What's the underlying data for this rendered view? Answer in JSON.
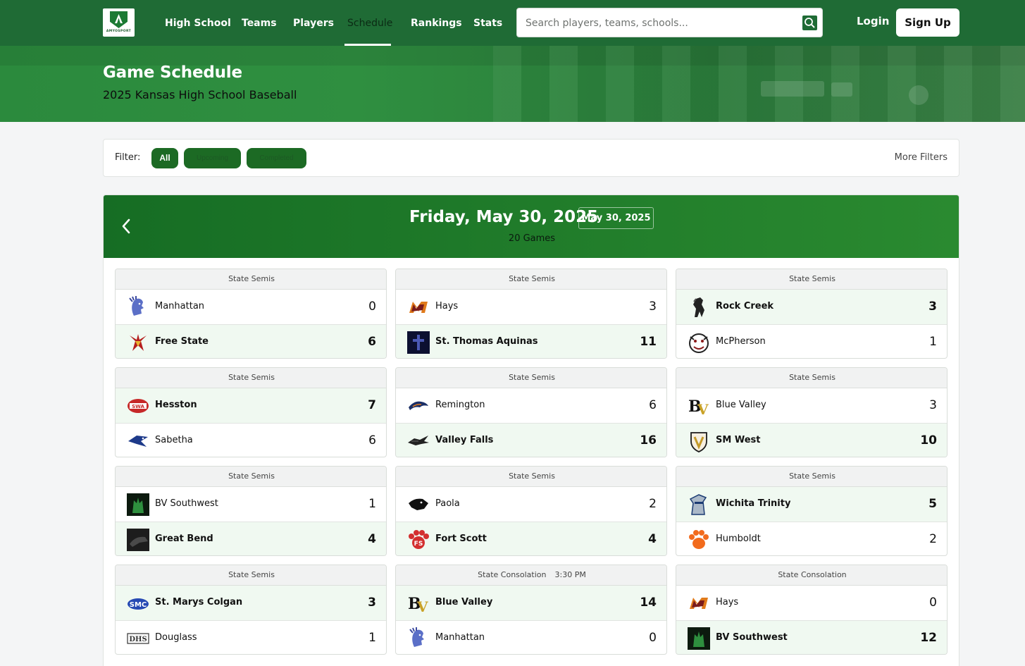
{
  "nav": {
    "logo_text": "AMYOSPORT",
    "links": [
      "High School",
      "Teams",
      "Players",
      "Schedule",
      "Rankings",
      "Stats"
    ],
    "active": "Schedule",
    "search_placeholder": "Search players, teams, schools...",
    "login": "Login",
    "signup": "Sign Up"
  },
  "hero": {
    "title": "Game Schedule",
    "subtitle": "2025 Kansas High School Baseball"
  },
  "filter": {
    "label": "Filter:",
    "chips": [
      "All",
      "Upcoming",
      "Completed"
    ],
    "more": "More Filters"
  },
  "day": {
    "title": "Friday, May 30, 2025",
    "badge": "May 30, 2025",
    "count": "20 Games"
  },
  "colors": {
    "brand": "#1f6b35",
    "win_row": "#f0f9f1",
    "chip": "#1c6a24"
  },
  "games": [
    {
      "stage": "State Semis",
      "time": "",
      "t1": "Manhattan",
      "s1": "0",
      "t2": "Free State",
      "s2": "6",
      "l1": "indian-logo",
      "l2": "firebird-logo",
      "win": 2
    },
    {
      "stage": "State Semis",
      "time": "",
      "t1": "Hays",
      "s1": "3",
      "t2": "St. Thomas Aquinas",
      "s2": "11",
      "l1": "hays-logo",
      "l2": "saint-logo",
      "win": 2
    },
    {
      "stage": "State Semis",
      "time": "",
      "t1": "Rock Creek",
      "s1": "3",
      "t2": "McPherson",
      "s2": "1",
      "l1": "mustang-logo",
      "l2": "bulldog-logo",
      "win": 1
    },
    {
      "stage": "State Semis",
      "time": "",
      "t1": "Hesston",
      "s1": "7",
      "t2": "Sabetha",
      "s2": "6",
      "l1": "hesston-logo",
      "l2": "bluejay-logo",
      "win": 1
    },
    {
      "stage": "State Semis",
      "time": "",
      "t1": "Remington",
      "s1": "6",
      "t2": "Valley Falls",
      "s2": "16",
      "l1": "bronco-logo",
      "l2": "dragon-logo",
      "win": 2
    },
    {
      "stage": "State Semis",
      "time": "",
      "t1": "Blue Valley",
      "s1": "3",
      "t2": "SM West",
      "s2": "10",
      "l1": "bv-logo",
      "l2": "viking-shield-logo",
      "win": 2
    },
    {
      "stage": "State Semis",
      "time": "",
      "t1": "BV Southwest",
      "s1": "1",
      "t2": "Great Bend",
      "s2": "4",
      "l1": "timberwolf-logo",
      "l2": "panther-logo",
      "win": 2
    },
    {
      "stage": "State Semis",
      "time": "",
      "t1": "Paola",
      "s1": "2",
      "t2": "Fort Scott",
      "s2": "4",
      "l1": "panther-head-logo",
      "l2": "tiger-paw-logo",
      "win": 2
    },
    {
      "stage": "State Semis",
      "time": "",
      "t1": "Wichita Trinity",
      "s1": "5",
      "t2": "Humboldt",
      "s2": "2",
      "l1": "knight-logo",
      "l2": "paw-logo",
      "win": 1
    },
    {
      "stage": "State Semis",
      "time": "",
      "t1": "St. Marys Colgan",
      "s1": "3",
      "t2": "Douglass",
      "s2": "1",
      "l1": "smc-logo",
      "l2": "dhs-logo",
      "win": 1
    },
    {
      "stage": "State Consolation",
      "time": "3:30 PM",
      "t1": "Blue Valley",
      "s1": "14",
      "t2": "Manhattan",
      "s2": "0",
      "l1": "bv-logo",
      "l2": "indian-logo",
      "win": 1
    },
    {
      "stage": "State Consolation",
      "time": "",
      "t1": "Hays",
      "s1": "0",
      "t2": "BV Southwest",
      "s2": "12",
      "l1": "hays-logo",
      "l2": "timberwolf-logo",
      "win": 2
    }
  ]
}
